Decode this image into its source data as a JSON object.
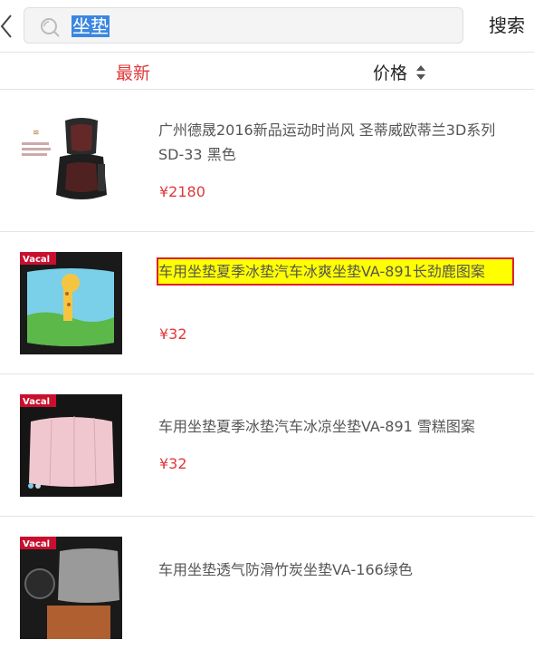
{
  "search": {
    "query": "坐垫",
    "button_label": "搜索"
  },
  "tabs": {
    "newest": "最新",
    "price": "价格"
  },
  "products": [
    {
      "title": "广州德晟2016新品运动时尚风 圣蒂威欧蒂兰3D系列 SD-33 黑色",
      "price": "¥2180"
    },
    {
      "title": "车用坐垫夏季冰垫汽车冰爽坐垫VA-891长劲鹿图案",
      "price": "¥32"
    },
    {
      "title": "车用坐垫夏季冰垫汽车冰凉坐垫VA-891 雪糕图案",
      "price": "¥32"
    },
    {
      "title": "车用坐垫透气防滑竹炭坐垫VA-166绿色",
      "price": ""
    }
  ],
  "colors": {
    "accent_red": "#e0393a",
    "selection_blue": "#3b87e0",
    "highlight_yellow": "#ffff00"
  }
}
